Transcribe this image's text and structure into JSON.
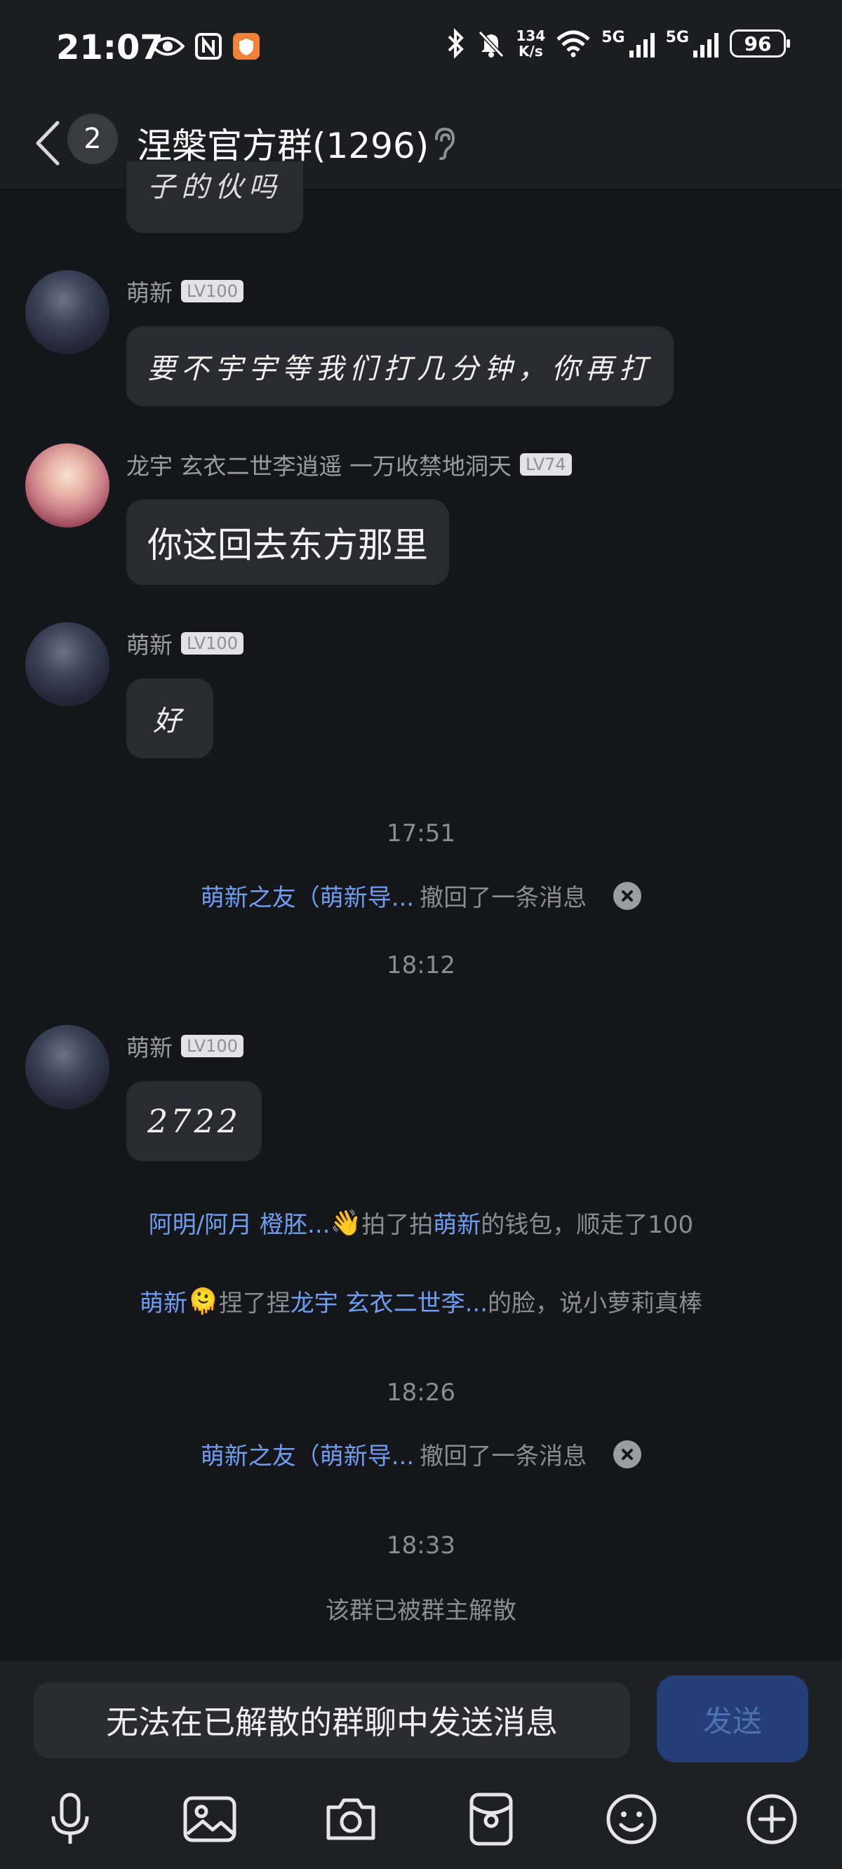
{
  "status_bar": {
    "time": "21:07",
    "net_speed_value": "134",
    "net_speed_unit": "K/s",
    "signal1_label": "5G",
    "signal2_label": "5G",
    "battery": "96"
  },
  "header": {
    "unread_count": "2",
    "title": "涅槃官方群(1296)"
  },
  "messages": [
    {
      "sender": "萌新",
      "level": "LV100",
      "text": "要不宇宇等我们打几分钟，你再打"
    },
    {
      "sender": "龙宇 玄衣二世李逍遥 一万收禁地洞天",
      "level": "LV74",
      "text": "你这回去东方那里"
    },
    {
      "sender": "萌新",
      "level": "LV100",
      "text": "好"
    },
    {
      "sender": "萌新",
      "level": "LV100",
      "text": "2722"
    }
  ],
  "partial_top_bubble": "子的伙吗",
  "timestamps": [
    "17:51",
    "18:12",
    "18:26",
    "18:33"
  ],
  "recall_notice": {
    "who": "萌新之友（萌新导...",
    "action": "撤回了一条消息"
  },
  "pat_notice": {
    "actor": "阿明/阿月  橙胚...",
    "emoji": "👋",
    "verb": "拍了拍",
    "target": "萌新",
    "rest": "的钱包，顺走了100"
  },
  "pinch_notice": {
    "actor": "萌新",
    "emoji": "🫠",
    "verb": "捏了捏",
    "target": "龙宇 玄衣二世李...",
    "rest": "的脸，说小萝莉真棒"
  },
  "disband_notice": "该群已被群主解散",
  "input": {
    "placeholder": "无法在已解散的群聊中发送消息",
    "send_label": "发送"
  },
  "toolbar_icons": [
    "microphone-icon",
    "image-icon",
    "camera-icon",
    "red-packet-icon",
    "emoji-icon",
    "plus-icon"
  ]
}
